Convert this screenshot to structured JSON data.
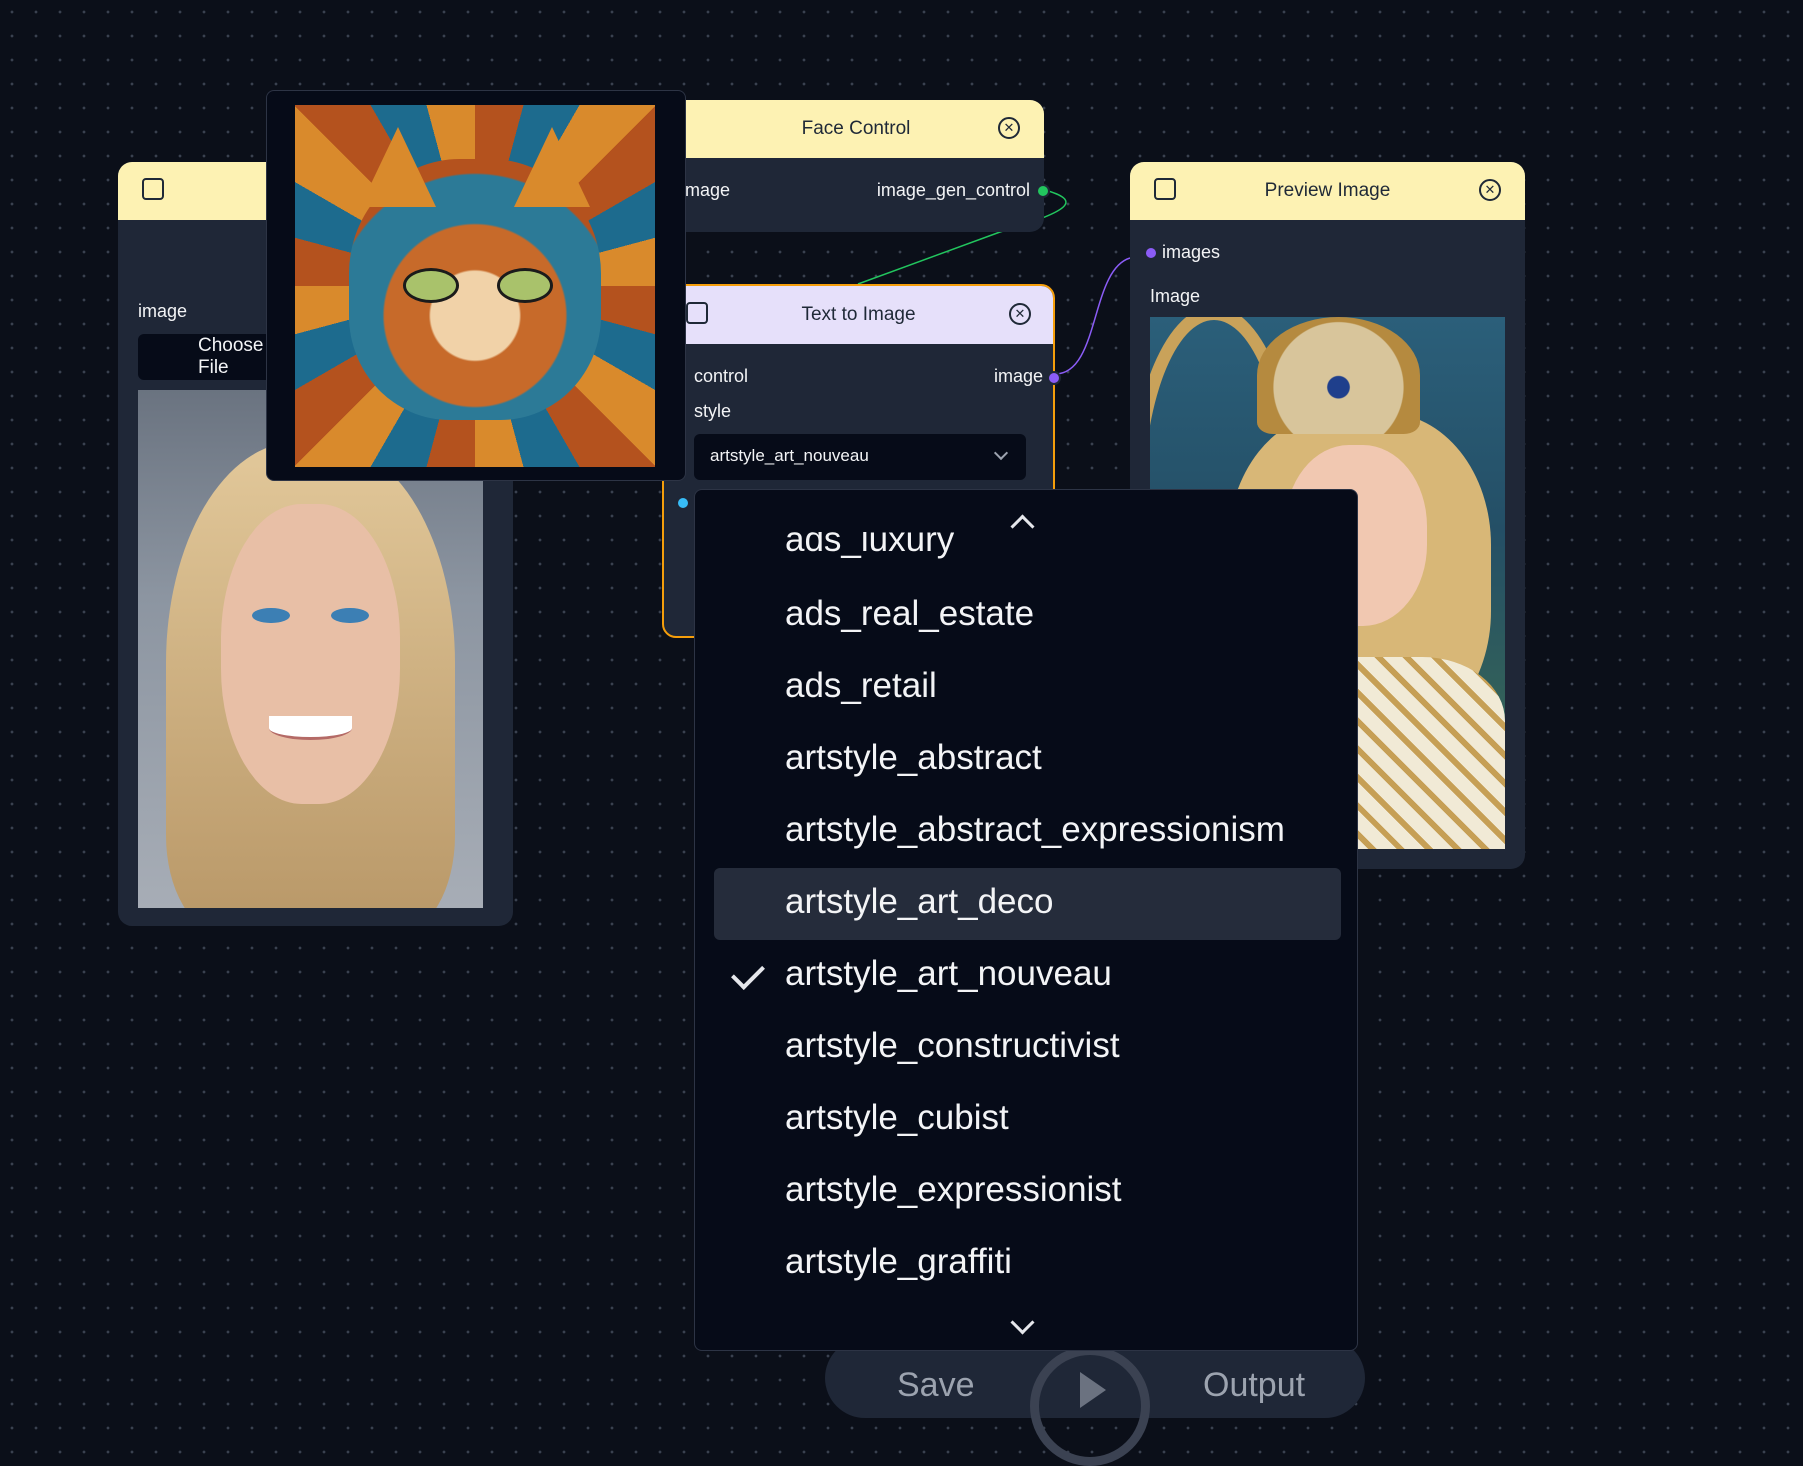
{
  "load_image_node": {
    "input_label": "image",
    "choose_file_label": "Choose File"
  },
  "face_control_node": {
    "title": "Face Control",
    "input_label": "mage",
    "output_label": "image_gen_control"
  },
  "text_to_image_node": {
    "title": "Text to Image",
    "input_control_label": "control",
    "input_style_label": "style",
    "output_label": "image",
    "style_value": "artstyle_art_nouveau"
  },
  "preview_image_node": {
    "title": "Preview Image",
    "input_label": "images",
    "image_label": "Image"
  },
  "style_dropdown": {
    "partial_top_option": "ads_luxury",
    "options": [
      "ads_real_estate",
      "ads_retail",
      "artstyle_abstract",
      "artstyle_abstract_expressionism",
      "artstyle_art_deco",
      "artstyle_art_nouveau",
      "artstyle_constructivist",
      "artstyle_cubist",
      "artstyle_expressionist",
      "artstyle_graffiti"
    ],
    "highlighted": "artstyle_art_deco",
    "selected": "artstyle_art_nouveau"
  },
  "bottom_toolbar": {
    "save_label": "Save",
    "output_label": "Output"
  },
  "colors": {
    "canvas": "#0b0f19",
    "node_body": "#1f2737",
    "header_yellow": "#fdf2b3",
    "header_lilac": "#e6e0fa",
    "selected_outline": "#f59e0b",
    "edge_green": "#22c55e",
    "edge_purple": "#8b5cf6"
  }
}
